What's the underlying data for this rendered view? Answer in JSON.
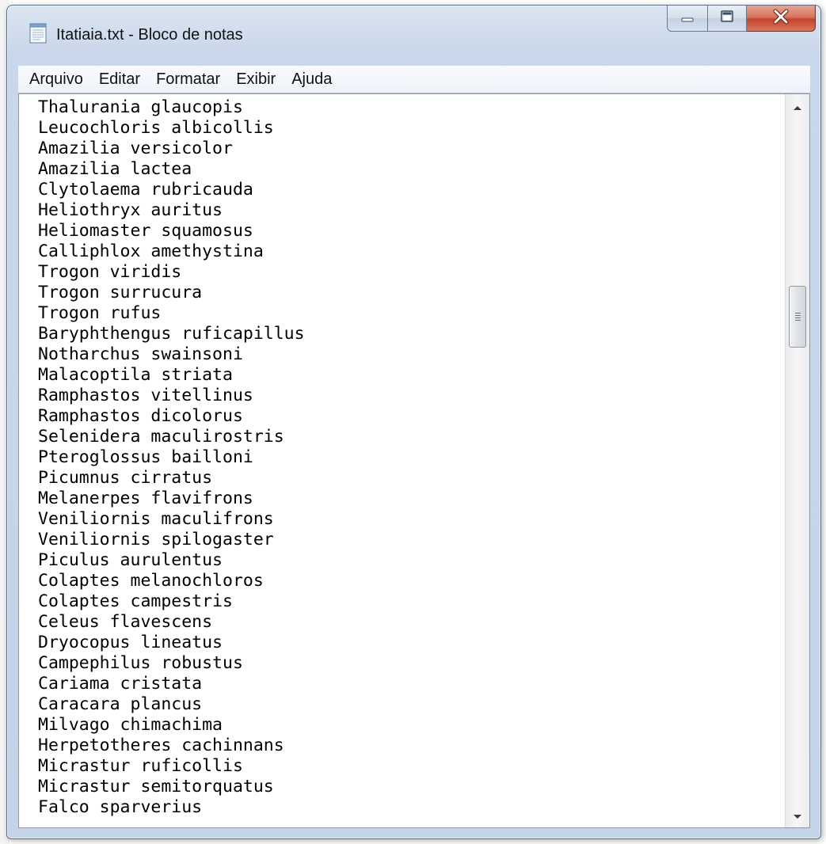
{
  "window": {
    "title": "Itatiaia.txt - Bloco de notas",
    "accent_close": "#c4432b"
  },
  "menu": {
    "items": [
      "Arquivo",
      "Editar",
      "Formatar",
      "Exibir",
      "Ajuda"
    ]
  },
  "editor": {
    "lines": [
      "Thalurania glaucopis",
      "Leucochloris albicollis",
      "Amazilia versicolor",
      "Amazilia lactea",
      "Clytolaema rubricauda",
      "Heliothryx auritus",
      "Heliomaster squamosus",
      "Calliphlox amethystina",
      "Trogon viridis",
      "Trogon surrucura",
      "Trogon rufus",
      "Baryphthengus ruficapillus",
      "Notharchus swainsoni",
      "Malacoptila striata",
      "Ramphastos vitellinus",
      "Ramphastos dicolorus",
      "Selenidera maculirostris",
      "Pteroglossus bailloni",
      "Picumnus cirratus",
      "Melanerpes flavifrons",
      "Veniliornis maculifrons",
      "Veniliornis spilogaster",
      "Piculus aurulentus",
      "Colaptes melanochloros",
      "Colaptes campestris",
      "Celeus flavescens",
      "Dryocopus lineatus",
      "Campephilus robustus",
      "Cariama cristata",
      "Caracara plancus",
      "Milvago chimachima",
      "Herpetotheres cachinnans",
      "Micrastur ruficollis",
      "Micrastur semitorquatus",
      "Falco sparverius"
    ]
  },
  "icons": {
    "app": "notepad-icon",
    "minimize": "minimize-icon",
    "maximize": "maximize-icon",
    "close": "close-icon",
    "scroll_up": "scroll-up-arrow-icon",
    "scroll_down": "scroll-down-arrow-icon"
  }
}
